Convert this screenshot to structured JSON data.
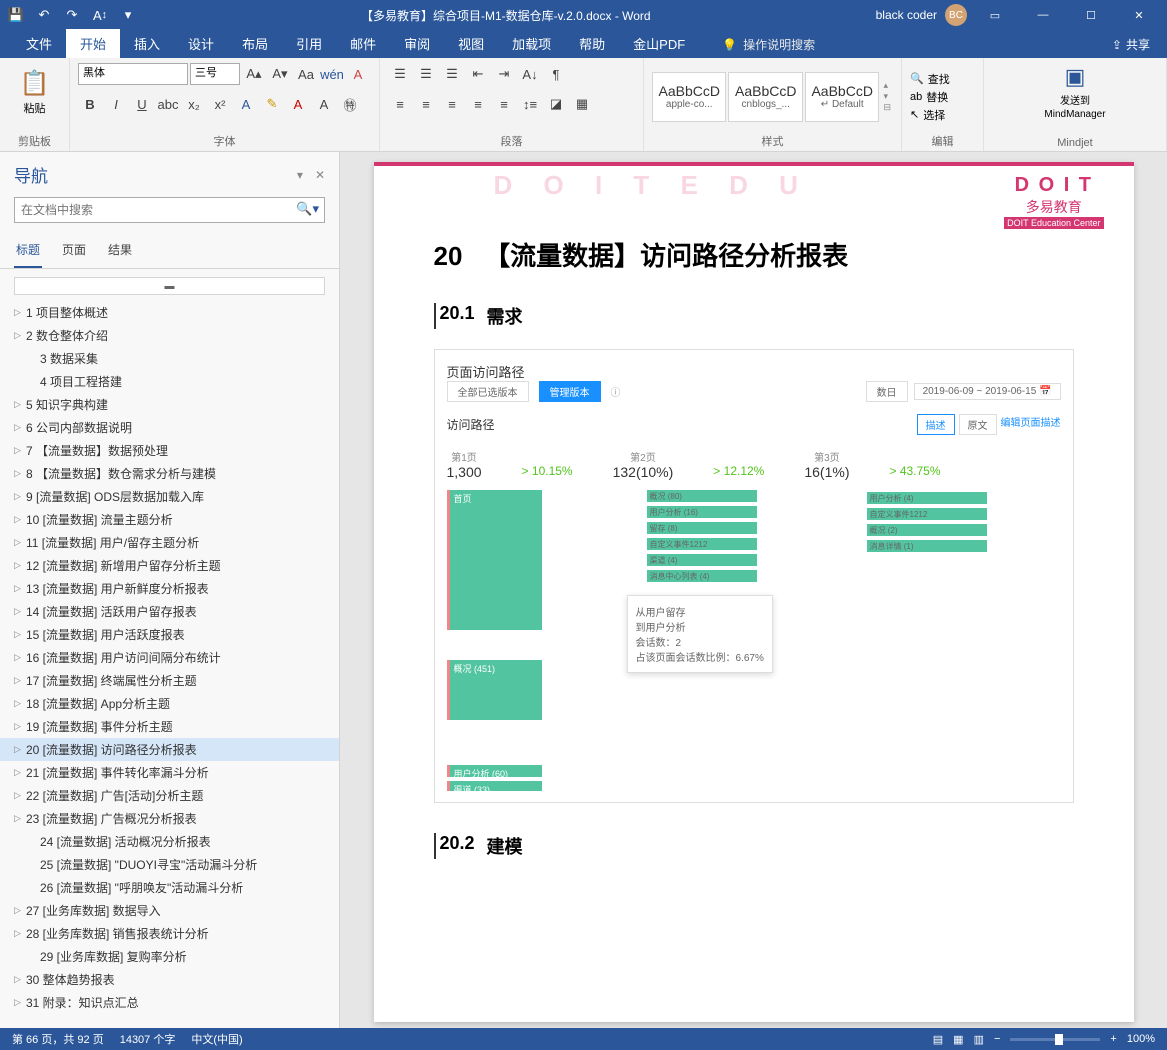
{
  "titlebar": {
    "title": "【多易教育】综合项目-M1-数据仓库-v.2.0.docx  -  Word",
    "user": "black coder",
    "avatar": "BC"
  },
  "ribbon_tabs": {
    "file": "文件",
    "items": [
      "开始",
      "插入",
      "设计",
      "布局",
      "引用",
      "邮件",
      "审阅",
      "视图",
      "加载项",
      "帮助",
      "金山PDF"
    ],
    "help_hint": "操作说明搜索",
    "share": "共享"
  },
  "ribbon": {
    "clipboard": {
      "label": "剪贴板",
      "paste": "粘贴"
    },
    "font": {
      "label": "字体",
      "family": "黑体",
      "size": "三号"
    },
    "paragraph": {
      "label": "段落"
    },
    "styles": {
      "label": "样式",
      "chips": [
        {
          "preview": "AaBbCcD",
          "name": "apple-co..."
        },
        {
          "preview": "AaBbCcD",
          "name": "cnblogs_..."
        },
        {
          "preview": "AaBbCcD",
          "name": "↵ Default"
        }
      ]
    },
    "editing": {
      "label": "编辑",
      "find": "查找",
      "replace": "替换",
      "select": "选择"
    },
    "mindjet": {
      "label": "Mindjet",
      "send": "发送到",
      "mm": "MindManager"
    }
  },
  "nav": {
    "title": "导航",
    "search_placeholder": "在文档中搜索",
    "tabs": [
      "标题",
      "页面",
      "结果"
    ],
    "items": [
      {
        "n": "1",
        "t": "项目整体概述",
        "e": true
      },
      {
        "n": "2",
        "t": "数仓整体介绍",
        "e": true
      },
      {
        "n": "3",
        "t": "数据采集",
        "e": false,
        "indent": true
      },
      {
        "n": "4",
        "t": "项目工程搭建",
        "e": false,
        "indent": true
      },
      {
        "n": "5",
        "t": "知识字典构建",
        "e": true
      },
      {
        "n": "6",
        "t": "公司内部数据说明",
        "e": true
      },
      {
        "n": "7",
        "t": "【流量数据】数据预处理",
        "e": true
      },
      {
        "n": "8",
        "t": "【流量数据】数仓需求分析与建模",
        "e": true
      },
      {
        "n": "9",
        "t": "[流量数据] ODS层数据加载入库",
        "e": true
      },
      {
        "n": "10",
        "t": "[流量数据] 流量主题分析",
        "e": true
      },
      {
        "n": "11",
        "t": "[流量数据] 用户/留存主题分析",
        "e": true
      },
      {
        "n": "12",
        "t": "[流量数据] 新增用户留存分析主题",
        "e": true
      },
      {
        "n": "13",
        "t": "[流量数据] 用户新鲜度分析报表",
        "e": true
      },
      {
        "n": "14",
        "t": "[流量数据] 活跃用户留存报表",
        "e": true
      },
      {
        "n": "15",
        "t": "[流量数据] 用户活跃度报表",
        "e": true
      },
      {
        "n": "16",
        "t": "[流量数据] 用户访问间隔分布统计",
        "e": true
      },
      {
        "n": "17",
        "t": "[流量数据] 终端属性分析主题",
        "e": true
      },
      {
        "n": "18",
        "t": "[流量数据] App分析主题",
        "e": true
      },
      {
        "n": "19",
        "t": "[流量数据] 事件分析主题",
        "e": true
      },
      {
        "n": "20",
        "t": "[流量数据] 访问路径分析报表",
        "e": true,
        "selected": true
      },
      {
        "n": "21",
        "t": "[流量数据] 事件转化率漏斗分析",
        "e": true
      },
      {
        "n": "22",
        "t": "[流量数据] 广告[活动]分析主题",
        "e": true
      },
      {
        "n": "23",
        "t": "[流量数据] 广告概况分析报表",
        "e": true
      },
      {
        "n": "24",
        "t": "[流量数据] 活动概况分析报表",
        "e": false,
        "indent": true
      },
      {
        "n": "25",
        "t": "[流量数据] \"DUOYI寻宝\"活动漏斗分析",
        "e": false,
        "indent": true
      },
      {
        "n": "26",
        "t": "[流量数据] \"呼朋唤友\"活动漏斗分析",
        "e": false,
        "indent": true
      },
      {
        "n": "27",
        "t": "[业务库数据] 数据导入",
        "e": true
      },
      {
        "n": "28",
        "t": "[业务库数据] 销售报表统计分析",
        "e": true
      },
      {
        "n": "29",
        "t": "[业务库数据] 复购率分析",
        "e": false,
        "indent": true
      },
      {
        "n": "30",
        "t": "整体趋势报表",
        "e": true
      },
      {
        "n": "31",
        "t": "附录：知识点汇总",
        "e": true
      }
    ]
  },
  "document": {
    "doit_big": "D O I T E D U",
    "doit_logo": "D O I T",
    "doit_cn": "多易教育",
    "doit_en": "DOIT Education Center",
    "h1_num": "20",
    "h1_text": "【流量数据】访问路径分析报表",
    "h2_1_num": "20.1",
    "h2_1_text": "需求",
    "h2_2_num": "20.2",
    "h2_2_text": "建模",
    "embed": {
      "title": "页面访问路径",
      "left_pill": "全部已选版本",
      "blue_pill": "管理版本",
      "right_pill": "数日",
      "date": "2019-06-09 ~ 2019-06-15",
      "path_title": "访问路径",
      "tab1": "描述",
      "tab2": "原文",
      "link": "编辑页面描述",
      "tooltip": {
        "l1": "从用户留存",
        "l2": "到用户分析",
        "l3": "会话数：2",
        "l4": "占该页面会话数比例：6.67%"
      }
    }
  },
  "chart_data": {
    "type": "sankey",
    "stages": [
      {
        "label": "第1页",
        "value": "1,300"
      },
      {
        "label": "第2页",
        "value": "132(10%)"
      },
      {
        "label": "第3页",
        "value": "16(1%)"
      }
    ],
    "transitions": [
      "10.15%",
      "12.12%",
      "43.75%"
    ],
    "nodes_col1": [
      {
        "name": "首页",
        "h": 140
      },
      {
        "name": "概况 (451)",
        "h": 60
      },
      {
        "name": "用户分析 (60)",
        "h": 12
      },
      {
        "name": "渠道 (33)",
        "h": 10
      }
    ],
    "nodes_col2": [
      {
        "name": "概况 (80)"
      },
      {
        "name": "用户分析 (16)"
      },
      {
        "name": "留存 (8)"
      },
      {
        "name": "自定义事件1212"
      },
      {
        "name": "渠道 (4)"
      },
      {
        "name": "消息中心列表 (4)"
      }
    ],
    "nodes_col3": [
      {
        "name": "用户分析 (4)"
      },
      {
        "name": "自定义事件1212"
      },
      {
        "name": "概况 (2)"
      },
      {
        "name": "消息详情 (1)"
      }
    ]
  },
  "statusbar": {
    "page": "第 66 页，共 92 页",
    "words": "14307 个字",
    "lang": "中文(中国)",
    "zoom": "100%"
  }
}
